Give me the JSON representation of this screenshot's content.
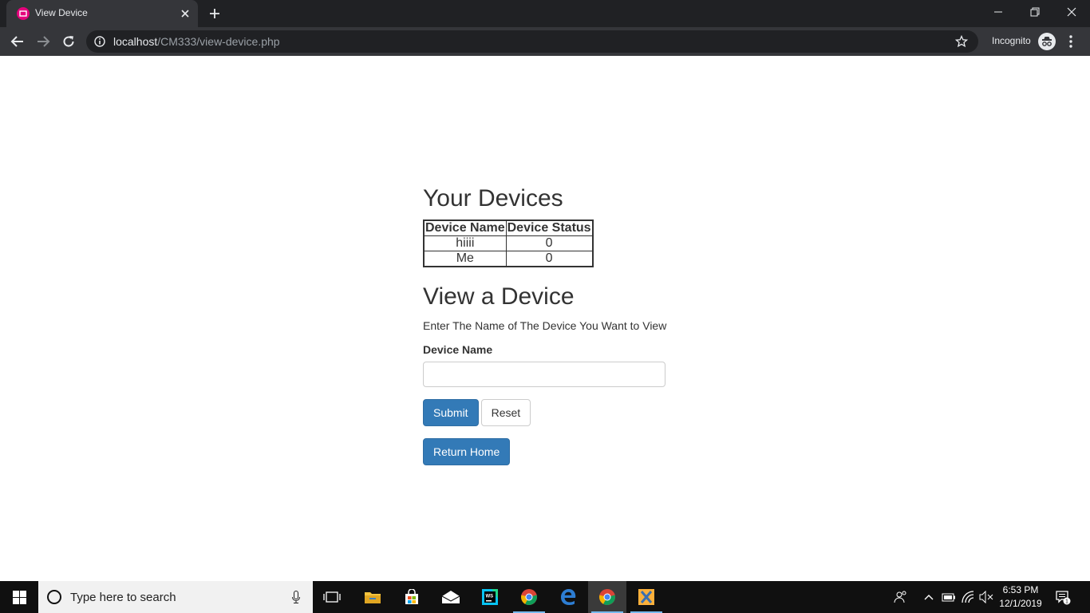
{
  "browser": {
    "tab_title": "View Device",
    "url_host": "localhost",
    "url_path": "/CM333/view-device.php",
    "mode_label": "Incognito"
  },
  "page": {
    "devices_heading": "Your Devices",
    "table": {
      "headers": [
        "Device Name",
        "Device Status"
      ],
      "rows": [
        [
          "hiiii",
          "0"
        ],
        [
          "Me",
          "0"
        ]
      ]
    },
    "view_heading": "View a Device",
    "intro_text": "Enter The Name of The Device You Want to View",
    "field_label": "Device Name",
    "field_value": "",
    "submit_label": "Submit",
    "reset_label": "Reset",
    "home_label": "Return Home"
  },
  "taskbar": {
    "search_placeholder": "Type here to search",
    "apps": [
      "task-view",
      "file-explorer",
      "microsoft-store",
      "mail",
      "webstorm",
      "chrome",
      "edge",
      "chrome",
      "xampp"
    ],
    "time": "6:53 PM",
    "date": "12/1/2019",
    "notification_count": "1"
  },
  "colors": {
    "primary_button": "#337ab7",
    "browser_dark": "#202124",
    "browser_toolbar": "#35363a",
    "favicon": "#e4007c"
  }
}
